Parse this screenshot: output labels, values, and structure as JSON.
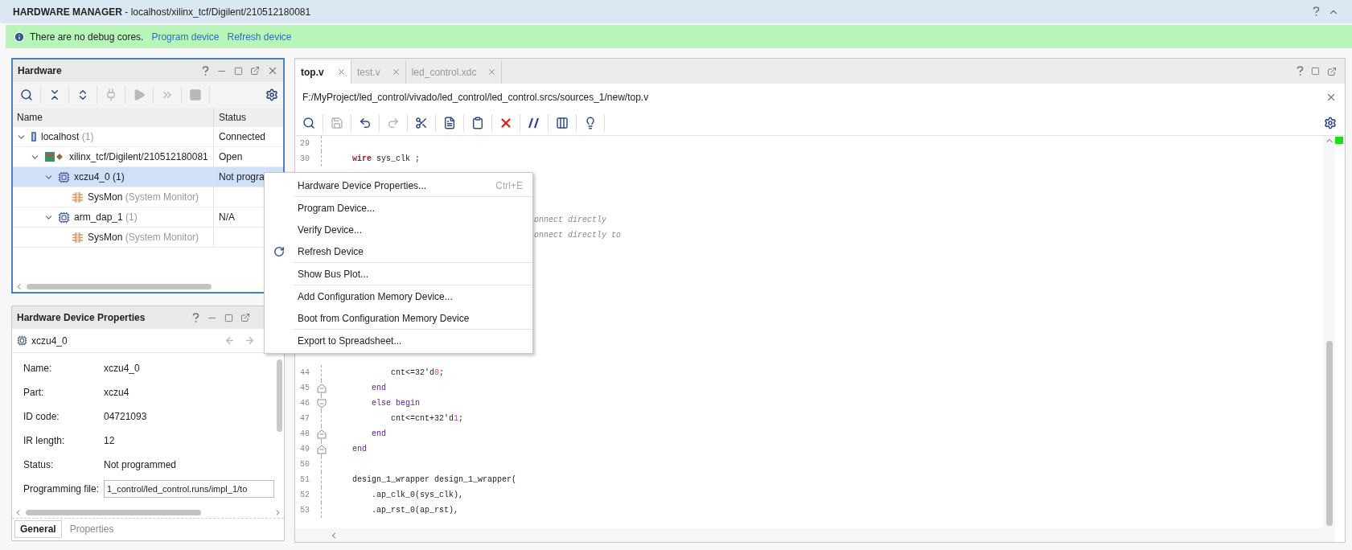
{
  "window": {
    "title": "**HARDWARE MANAGER** - localhost/xilinx_tcf/Digilent/210512180081"
  },
  "info_bar": {
    "message": "There are no debug cores.",
    "links": [
      "Program device",
      "Refresh device"
    ]
  },
  "hardware_panel": {
    "title": "Hardware",
    "toolbar": [
      {
        "kind": "search",
        "disabled": false
      },
      {
        "kind": "collapse",
        "disabled": false
      },
      {
        "kind": "expand",
        "disabled": false
      },
      {
        "kind": "plug",
        "disabled": true
      },
      {
        "kind": "play",
        "disabled": true
      },
      {
        "kind": "forward",
        "disabled": true
      },
      {
        "kind": "stop",
        "disabled": true
      }
    ],
    "columns": [
      "Name",
      "Status"
    ],
    "tree": [
      {
        "name": "localhost",
        "count": "(1)",
        "status": "Connected",
        "kind": "server",
        "expanded": true,
        "selected": false,
        "children": [
          {
            "name": "xilinx_tcf/Digilent/210512180081",
            "status": "Open",
            "kind": "board",
            "expanded": true,
            "selected": false,
            "children": [
              {
                "name": "xczu4_0",
                "count": "(1)",
                "status": "Not progra",
                "kind": "chip",
                "expanded": true,
                "selected": true,
                "children": [
                  {
                    "name": "SysMon",
                    "count": "(System Monitor)",
                    "kind": "sysmon",
                    "selected": false
                  }
                ]
              },
              {
                "name": "arm_dap_1",
                "count": "(1)",
                "status": "N/A",
                "kind": "chip",
                "expanded": true,
                "selected": false,
                "children": [
                  {
                    "name": "SysMon",
                    "count": "(System Monitor)",
                    "kind": "sysmon",
                    "selected": false
                  }
                ]
              }
            ]
          }
        ]
      }
    ]
  },
  "properties_panel": {
    "title": "Hardware Device Properties",
    "object": "xczu4_0",
    "rows": [
      {
        "label": "Name:",
        "value": "xczu4_0",
        "kind": "text"
      },
      {
        "label": "Part:",
        "value": "xczu4",
        "kind": "text"
      },
      {
        "label": "ID code:",
        "value": "04721093",
        "kind": "text"
      },
      {
        "label": "IR length:",
        "value": "12",
        "kind": "text"
      },
      {
        "label": "Status:",
        "value": "Not programmed",
        "kind": "text"
      },
      {
        "label": "Programming file:",
        "value": "1_control/led_control.runs/impl_1/to",
        "kind": "field"
      }
    ],
    "tabs": [
      {
        "label": "General",
        "selected": true
      },
      {
        "label": "Properties",
        "selected": false
      }
    ]
  },
  "editor": {
    "tabs": [
      {
        "label": "top.v",
        "selected": true
      },
      {
        "label": "test.v",
        "selected": false
      },
      {
        "label": "led_control.xdc",
        "selected": false
      }
    ],
    "path": "F:/MyProject/led_control/vivado/led_control/led_control.srcs/sources_1/new/top.v",
    "toolbar": [
      {
        "kind": "search",
        "disabled": false
      },
      {
        "kind": "save",
        "disabled": true
      },
      {
        "kind": "undo",
        "disabled": false
      },
      {
        "kind": "redo",
        "disabled": true
      },
      {
        "kind": "cut",
        "disabled": false
      },
      {
        "kind": "copy",
        "disabled": false
      },
      {
        "kind": "paste",
        "disabled": false
      },
      {
        "kind": "delete",
        "disabled": false
      },
      {
        "kind": "comment",
        "disabled": false
      },
      {
        "kind": "columns",
        "disabled": false
      },
      {
        "kind": "hint",
        "disabled": false
      }
    ],
    "lines": [
      {
        "number": "29",
        "kind": "code"
      },
      {
        "number": "30",
        "kind": "code",
        "segments": [
          {
            "text": "    wire",
            "kind": "type"
          },
          {
            "text": " sys_clk ;",
            "kind": "plain"
          }
        ]
      },
      {
        "kind": "fragment",
        "segments": [
          {
            "text": "onnect directly",
            "kind": "comment"
          }
        ]
      },
      {
        "kind": "fragment",
        "segments": [
          {
            "text": "onnect directly to",
            "kind": "comment"
          }
        ]
      },
      {
        "number": "44",
        "kind": "code",
        "segments": [
          {
            "text": "            cnt<=32'd",
            "kind": "plain"
          },
          {
            "text": "0",
            "kind": "number"
          },
          {
            "text": ";",
            "kind": "plain"
          }
        ]
      },
      {
        "number": "45",
        "kind": "code",
        "fold_start": false,
        "segments": [
          {
            "text": "        end",
            "kind": "keyword"
          }
        ]
      },
      {
        "number": "46",
        "kind": "code",
        "fold_start": true,
        "segments": [
          {
            "text": "        else begin",
            "kind": "keyword"
          }
        ]
      },
      {
        "number": "47",
        "kind": "code",
        "segments": [
          {
            "text": "            cnt<=cnt+32'd",
            "kind": "plain"
          },
          {
            "text": "1",
            "kind": "number"
          },
          {
            "text": ";",
            "kind": "plain"
          }
        ]
      },
      {
        "number": "48",
        "kind": "code",
        "fold_start": false,
        "segments": [
          {
            "text": "        end",
            "kind": "keyword"
          }
        ]
      },
      {
        "number": "49",
        "kind": "code",
        "fold_start": false,
        "segments": [
          {
            "text": "    end",
            "kind": "keyword"
          }
        ]
      },
      {
        "number": "50",
        "kind": "code"
      },
      {
        "number": "51",
        "kind": "code",
        "segments": [
          {
            "text": "    design_1_wrapper design_1_wrapper(",
            "kind": "plain"
          }
        ]
      },
      {
        "number": "52",
        "kind": "code",
        "segments": [
          {
            "text": "        .ap_clk_0(sys_clk),",
            "kind": "plain"
          }
        ]
      },
      {
        "number": "53",
        "kind": "code",
        "segments": [
          {
            "text": "        .ap_rst_0(ap_rst),",
            "kind": "plain"
          }
        ]
      }
    ]
  },
  "context_menu": {
    "sections": [
      [
        {
          "label": "Hardware Device Properties...",
          "shortcut": "Ctrl+E",
          "kind": "plain"
        }
      ],
      [
        {
          "label": "Program Device...",
          "kind": "plain"
        },
        {
          "label": "Verify Device...",
          "kind": "plain"
        },
        {
          "label": "Refresh Device",
          "kind": "refresh"
        }
      ],
      [
        {
          "label": "Show Bus Plot...",
          "kind": "plain"
        }
      ],
      [
        {
          "label": "Add Configuration Memory Device...",
          "kind": "plain"
        },
        {
          "label": "Boot from Configuration Memory Device",
          "kind": "plain"
        }
      ],
      [
        {
          "label": "Export to Spreadsheet...",
          "kind": "plain"
        }
      ]
    ]
  }
}
